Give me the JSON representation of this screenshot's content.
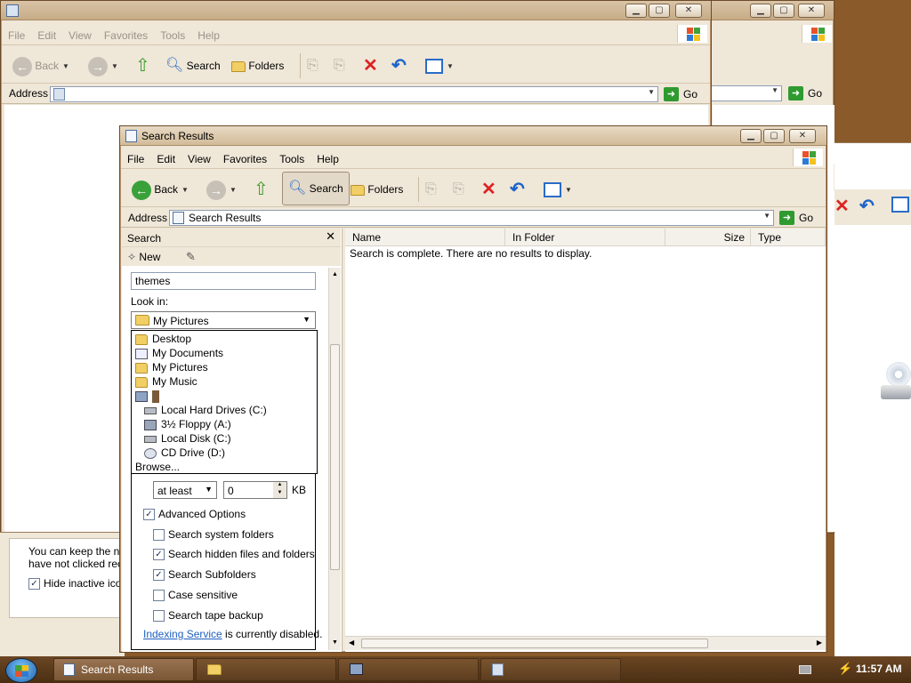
{
  "bg_windows": {
    "menu": [
      "File",
      "Edit",
      "View",
      "Favorites",
      "Tools",
      "Help"
    ],
    "back": "Back",
    "search": "Search",
    "folders": "Folders",
    "address_label": "Address",
    "go": "Go"
  },
  "taskbar_tray_dialog": {
    "text1": "You can keep the no",
    "text2": "have not clicked rece",
    "hide_label": "Hide inactive icon"
  },
  "main": {
    "title": "Search Results",
    "menu": [
      "File",
      "Edit",
      "View",
      "Favorites",
      "Tools",
      "Help"
    ],
    "toolbar": {
      "back": "Back",
      "search": "Search",
      "folders": "Folders"
    },
    "address_label": "Address",
    "address_value": "Search Results",
    "go": "Go",
    "pane": {
      "title": "Search",
      "new": "New",
      "query": "themes",
      "look_in_label": "Look in:",
      "look_in_value": "My Pictures",
      "dropdown": [
        "Desktop",
        "My Documents",
        "My Pictures",
        "My Music",
        "",
        "Local Hard Drives (C:)",
        "3½ Floppy (A:)",
        "Local Disk (C:)",
        "CD Drive (D:)",
        "Browse..."
      ],
      "size_mode": "at least",
      "size_value": "0",
      "size_unit": "KB",
      "advanced": "Advanced Options",
      "options": [
        {
          "label": "Search system folders",
          "checked": false
        },
        {
          "label": "Search hidden files and folders",
          "checked": true
        },
        {
          "label": "Search Subfolders",
          "checked": true
        },
        {
          "label": "Case sensitive",
          "checked": false
        },
        {
          "label": "Search tape backup",
          "checked": false
        }
      ],
      "indexing_link": "Indexing Service",
      "indexing_rest": " is currently disabled."
    },
    "columns": [
      "Name",
      "In Folder",
      "Size",
      "Type"
    ],
    "message": "Search is complete. There are no results to display."
  },
  "taskbar": {
    "items": [
      "Search Results"
    ],
    "clock": "11:57 AM"
  }
}
